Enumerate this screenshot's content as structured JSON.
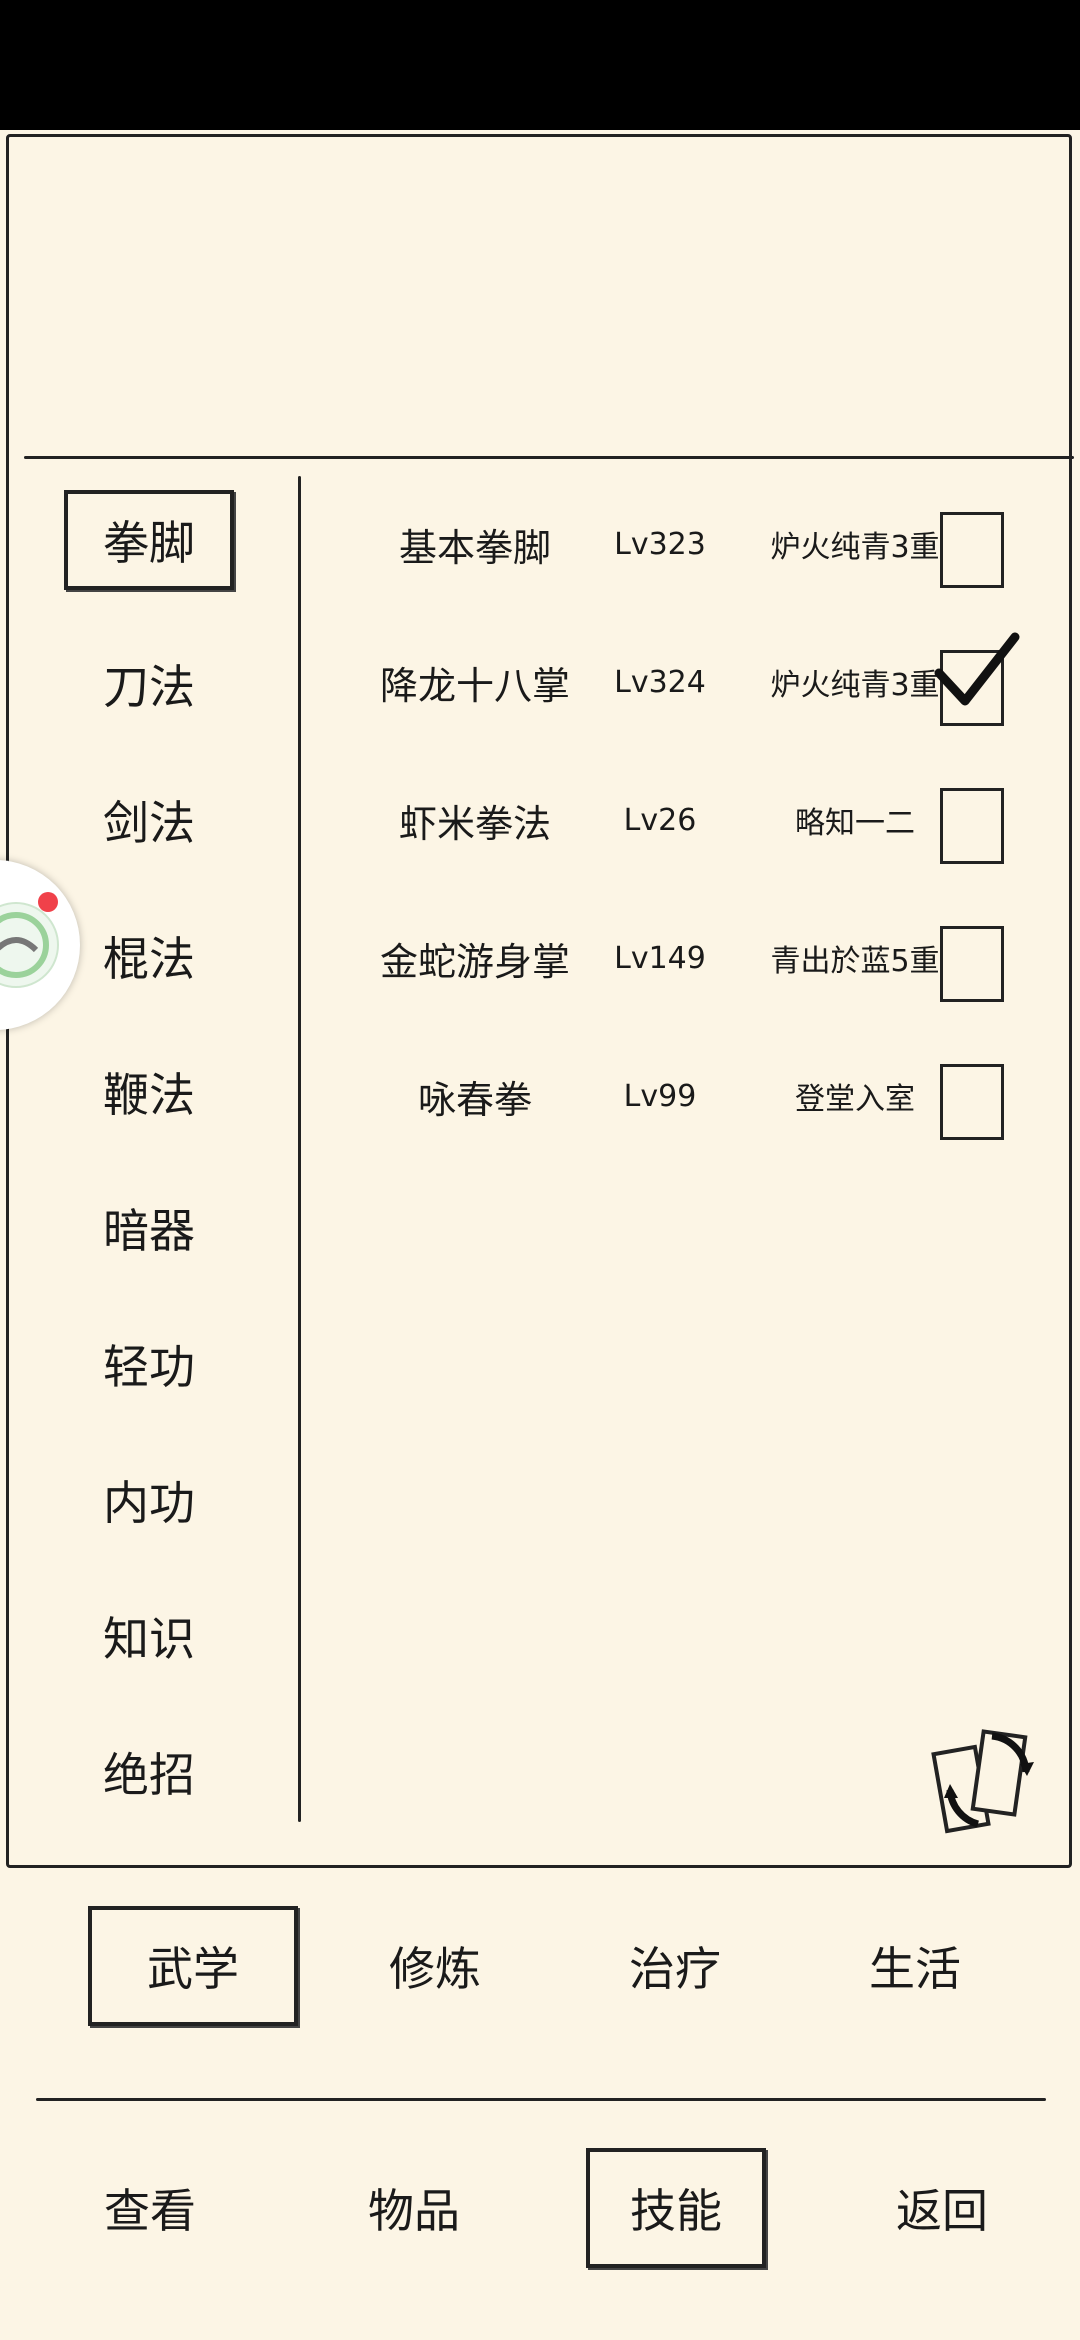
{
  "categories": [
    "拳脚",
    "刀法",
    "剑法",
    "棍法",
    "鞭法",
    "暗器",
    "轻功",
    "内功",
    "知识",
    "绝招"
  ],
  "selected_category": "拳脚",
  "skills": [
    {
      "name": "基本拳脚",
      "level": "Lv323",
      "rank": "炉火纯青3重",
      "checked": false
    },
    {
      "name": "降龙十八掌",
      "level": "Lv324",
      "rank": "炉火纯青3重",
      "checked": true
    },
    {
      "name": "虾米拳法",
      "level": "Lv26",
      "rank": "略知一二",
      "checked": false
    },
    {
      "name": "金蛇游身掌",
      "level": "Lv149",
      "rank": "青出於蓝5重",
      "checked": false
    },
    {
      "name": "咏春拳",
      "level": "Lv99",
      "rank": "登堂入室",
      "checked": false
    }
  ],
  "tabs": [
    "武学",
    "修炼",
    "治疗",
    "生活"
  ],
  "selected_tab": "武学",
  "nav": [
    "查看",
    "物品",
    "技能",
    "返回"
  ],
  "selected_nav": "技能",
  "icons": {
    "floating_widget": "app-assistant-icon",
    "refresh": "refresh-cards-icon",
    "check": "checkmark-icon"
  }
}
